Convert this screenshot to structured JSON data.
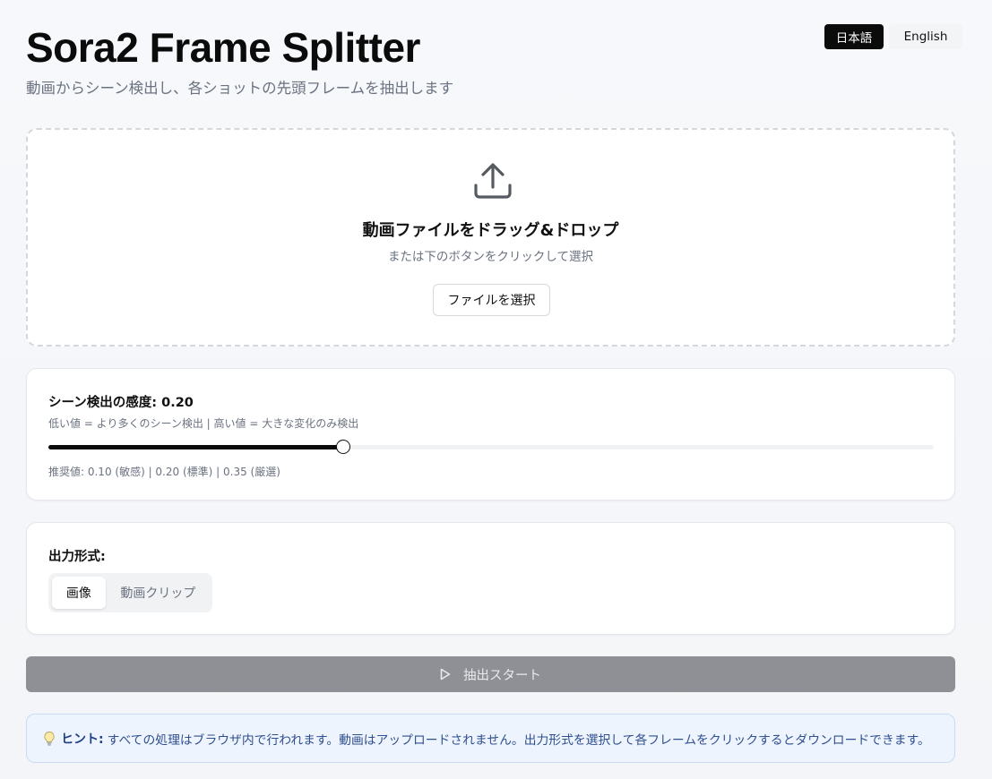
{
  "header": {
    "title": "Sora2 Frame Splitter",
    "subtitle": "動画からシーン検出し、各ショットの先頭フレームを抽出します"
  },
  "language": {
    "options": [
      "日本語",
      "English"
    ],
    "selected": "日本語"
  },
  "dropzone": {
    "icon": "upload-icon",
    "title": "動画ファイルをドラッグ&ドロップ",
    "subtitle": "または下のボタンをクリックして選択",
    "button_label": "ファイルを選択"
  },
  "sensitivity": {
    "label": "シーン検出の感度: 0.20",
    "help": "低い値 = より多くのシーン検出 | 高い値 = 大きな変化のみ検出",
    "value": 0.2,
    "min": 0.0,
    "max": 0.6,
    "recommended": "推奨値: 0.10 (敏感) | 0.20 (標準) | 0.35 (厳選)"
  },
  "output": {
    "label": "出力形式:",
    "options": [
      "画像",
      "動画クリップ"
    ],
    "selected": "画像"
  },
  "start_button": {
    "icon": "play-icon",
    "label": "抽出スタート"
  },
  "hint": {
    "icon": "lightbulb-icon",
    "label": "ヒント:",
    "text": "すべての処理はブラウザ内で行われます。動画はアップロードされません。出力形式を選択して各フレームをクリックするとダウンロードできます。"
  },
  "colors": {
    "accent": "#0b0b0b",
    "disabled_button": "#8e9095",
    "hint_background": "#eef4fd",
    "hint_border": "#c9dbf5"
  }
}
